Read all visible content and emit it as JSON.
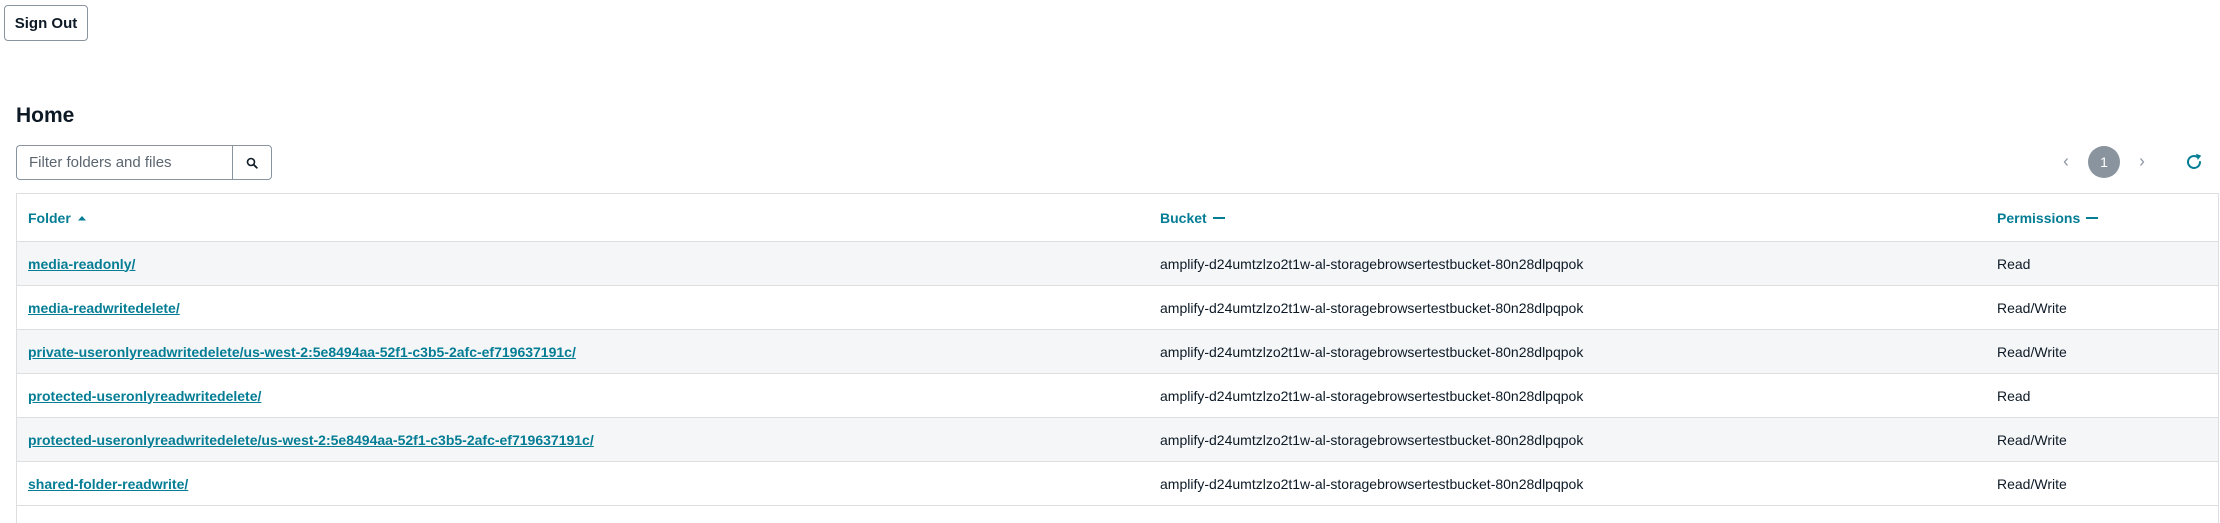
{
  "header": {
    "sign_out_label": "Sign Out"
  },
  "page": {
    "title": "Home"
  },
  "search": {
    "placeholder": "Filter folders and files",
    "value": "",
    "icon": "search-icon"
  },
  "pagination": {
    "current_page": "1",
    "prev_icon": "chevron-left-icon",
    "next_icon": "chevron-right-icon"
  },
  "refresh": {
    "icon": "refresh-icon",
    "color": "#047d95"
  },
  "table": {
    "columns": [
      {
        "label": "Folder",
        "sort": "ascending"
      },
      {
        "label": "Bucket",
        "sort": "none"
      },
      {
        "label": "Permissions",
        "sort": "none"
      }
    ],
    "rows": [
      {
        "folder": "media-readonly/",
        "bucket": "amplify-d24umtzlzo2t1w-al-storagebrowsertestbucket-80n28dlpqpok",
        "permissions": "Read"
      },
      {
        "folder": "media-readwritedelete/",
        "bucket": "amplify-d24umtzlzo2t1w-al-storagebrowsertestbucket-80n28dlpqpok",
        "permissions": "Read/Write"
      },
      {
        "folder": "private-useronlyreadwritedelete/us-west-2:5e8494aa-52f1-c3b5-2afc-ef719637191c/",
        "bucket": "amplify-d24umtzlzo2t1w-al-storagebrowsertestbucket-80n28dlpqpok",
        "permissions": "Read/Write"
      },
      {
        "folder": "protected-useronlyreadwritedelete/",
        "bucket": "amplify-d24umtzlzo2t1w-al-storagebrowsertestbucket-80n28dlpqpok",
        "permissions": "Read"
      },
      {
        "folder": "protected-useronlyreadwritedelete/us-west-2:5e8494aa-52f1-c3b5-2afc-ef719637191c/",
        "bucket": "amplify-d24umtzlzo2t1w-al-storagebrowsertestbucket-80n28dlpqpok",
        "permissions": "Read/Write"
      },
      {
        "folder": "shared-folder-readwrite/",
        "bucket": "amplify-d24umtzlzo2t1w-al-storagebrowsertestbucket-80n28dlpqpok",
        "permissions": "Read/Write"
      }
    ]
  },
  "colors": {
    "accent": "#047d95",
    "stripe": "#f5f6f7",
    "border": "#dcdee0"
  }
}
